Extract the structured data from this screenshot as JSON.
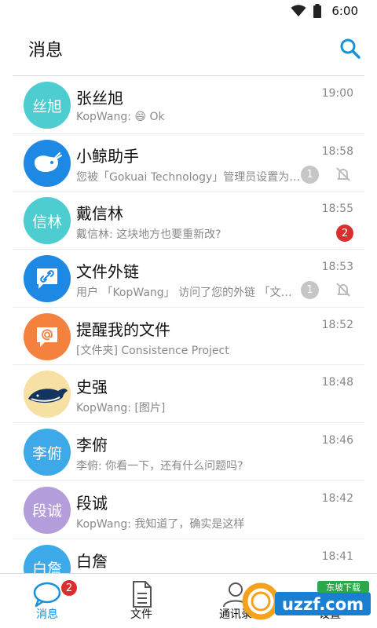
{
  "status_bar": {
    "time": "6:00"
  },
  "header": {
    "title": "消息"
  },
  "conversations": [
    {
      "name": "张丝旭",
      "time": "19:00",
      "preview_prefix": "KopWang: ",
      "preview_emoji": "😄",
      "preview_suffix": " Ok",
      "avatar_text": "丝旭",
      "avatar_color": "#4ecdd1"
    },
    {
      "name": "小鲸助手",
      "time": "18:58",
      "preview": "您被「Gokuai Technology」管理员设置为…",
      "muted_count": "1",
      "avatar_color": "#1e88e5"
    },
    {
      "name": "戴信林",
      "time": "18:55",
      "preview": "戴信林: 这块地方也要重新改?",
      "unread": "2",
      "avatar_text": "信林",
      "avatar_color": "#4ecdd1"
    },
    {
      "name": "文件外链",
      "time": "18:53",
      "preview": "用户 「KopWang」 访问了您的外链 「文…",
      "muted_count": "1",
      "avatar_color": "#1e88e5"
    },
    {
      "name": "提醒我的文件",
      "time": "18:52",
      "preview": "[文件夹] Consistence Project",
      "avatar_color": "#f5813f"
    },
    {
      "name": "史强",
      "time": "18:48",
      "preview": "KopWang: [图片]",
      "avatar_color": "#f7e0a3"
    },
    {
      "name": "李俯",
      "time": "18:46",
      "preview": "李俯: 你看一下，还有什么问题吗?",
      "avatar_text": "李俯",
      "avatar_color": "#3ea9e8"
    },
    {
      "name": "段诚",
      "time": "18:42",
      "preview": "KopWang: 我知道了，确实是这样",
      "avatar_text": "段诚",
      "avatar_color": "#b39ddb"
    },
    {
      "name": "白詹",
      "time": "18:41",
      "avatar_text": "白詹",
      "avatar_color": "#3ea9e8"
    }
  ],
  "bottom_nav": {
    "messages": {
      "label": "消息",
      "badge": "2"
    },
    "files": {
      "label": "文件"
    },
    "contacts": {
      "label": "通讯录"
    },
    "settings": {
      "label": "设置"
    }
  },
  "watermark": {
    "text": "uzzf.com",
    "tag": "东坡下载"
  },
  "colors": {
    "accent": "#1a90d9",
    "badge_red": "#d9302f",
    "muted_grey": "#c6c6c6"
  }
}
